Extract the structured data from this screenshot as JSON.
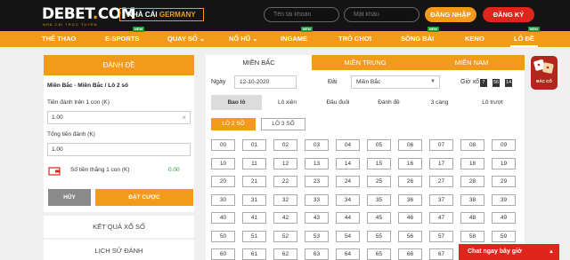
{
  "header": {
    "logo": "DEBET",
    "logo_dot": ".",
    "logo_tld": "COM",
    "logo_sub": "NHÀ CÁI TRỰC TUYẾN",
    "germany_prefix": "NHÀ CÁI",
    "germany_highlight": "GERMANY",
    "username_placeholder": "Tên tài khoản",
    "password_placeholder": "Mật khẩu",
    "login_label": "ĐĂNG NHẬP",
    "register_label": "ĐĂNG KÝ"
  },
  "nav": {
    "items": [
      {
        "label": "THỂ THAO"
      },
      {
        "label": "E-SPORTS",
        "badge": "NEW"
      },
      {
        "label": "QUAY SỐ ⌄"
      },
      {
        "label": "NỔ HŨ ⌄"
      },
      {
        "label": "INGAME",
        "badge": "NEW"
      },
      {
        "label": "TRÒ CHƠI"
      },
      {
        "label": "SÒNG BÀI",
        "badge": "NEW"
      },
      {
        "label": "KENO"
      },
      {
        "label": "LÔ ĐỀ",
        "badge": "NEW"
      }
    ],
    "active_index": 8
  },
  "left": {
    "title": "ĐÁNH ĐỀ",
    "bet_name": "Miền Bắc - Miền Bắc / Lô 2 số",
    "per_label": "Tiền đánh trên 1 con (K)",
    "per_value": "1.00",
    "total_label": "Tổng tiền đánh (K)",
    "total_value": "1.00",
    "win_label": "Số tiền thắng 1 con (K)",
    "win_value": "0.00",
    "cancel_label": "HỦY",
    "place_label": "ĐẶT CƯỢC",
    "results_link": "KẾT QUẢ XỔ SỐ",
    "history_link": "LỊCH SỬ ĐÁNH"
  },
  "main": {
    "regions": [
      "MIỀN BẮC",
      "MIỀN TRUNG",
      "MIỀN NAM"
    ],
    "active_region": 0,
    "date_label": "Ngày",
    "date_value": "12-10-2020",
    "station_label": "Đài",
    "station_value": "Miền Bắc",
    "draw_label": "Giờ xổ",
    "clock": [
      "7",
      "56",
      "14"
    ],
    "bet_types": [
      "Bao lô",
      "Lô xiên",
      "Đầu đuôi",
      "Đánh đề",
      "3 càng",
      "Lô trượt"
    ],
    "active_bet_type": 0,
    "sub_types": [
      "LÔ 2 SỐ",
      "LÔ 3 SỐ"
    ],
    "active_sub_type": 0,
    "numbers": [
      "00",
      "01",
      "02",
      "03",
      "04",
      "05",
      "06",
      "07",
      "08",
      "09",
      "10",
      "11",
      "12",
      "13",
      "14",
      "15",
      "16",
      "17",
      "18",
      "19",
      "20",
      "21",
      "22",
      "23",
      "24",
      "25",
      "26",
      "27",
      "28",
      "29",
      "30",
      "31",
      "32",
      "33",
      "34",
      "35",
      "36",
      "37",
      "38",
      "39",
      "40",
      "41",
      "42",
      "43",
      "44",
      "45",
      "46",
      "47",
      "48",
      "49",
      "50",
      "51",
      "52",
      "53",
      "54",
      "55",
      "56",
      "57",
      "58",
      "59",
      "60",
      "61",
      "62",
      "63",
      "64",
      "65",
      "66",
      "67",
      "68",
      "69"
    ]
  },
  "floater": {
    "label": "BẮC CỔ"
  },
  "chat": {
    "label": "Chat ngay bây giờ"
  },
  "colors": {
    "accent": "#f39a1b",
    "danger": "#e0261c",
    "dark": "#141414"
  }
}
